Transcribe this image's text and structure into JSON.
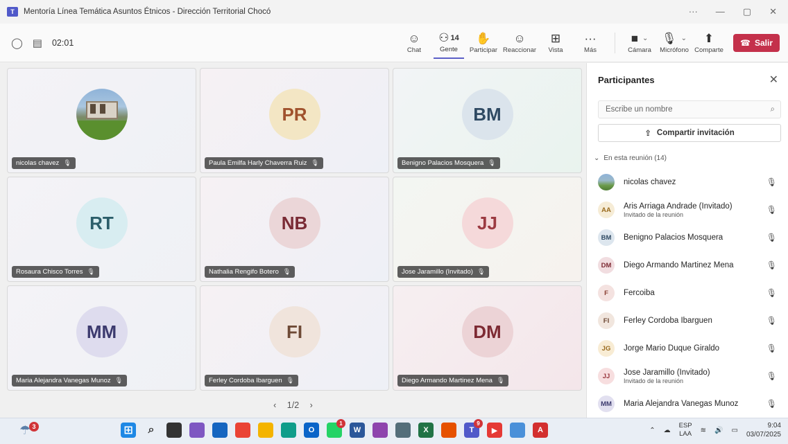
{
  "window": {
    "title": "Mentoría Línea Temática Asuntos Étnicos - Dirección Territorial Chocó",
    "controls": [
      "···",
      "—",
      "▢",
      "✕"
    ]
  },
  "toolbar": {
    "timer": "02:01",
    "buttons": {
      "chat": "Chat",
      "people": "Gente",
      "people_count": "14",
      "raise": "Participar",
      "react": "Reaccionar",
      "view": "Vista",
      "more": "Más",
      "camera": "Cámara",
      "mic": "Micrófono",
      "share": "Comparte",
      "leave": "Salir"
    }
  },
  "grid": {
    "tiles": [
      {
        "initials": "",
        "name": "nicolas chavez",
        "photo": true
      },
      {
        "initials": "PR",
        "name": "Paula Emilfa Harly Chaverra Ruiz",
        "bg": "#f3e6c4",
        "fg": "#a0522d"
      },
      {
        "initials": "BM",
        "name": "Benigno Palacios Mosquera",
        "bg": "#dbe4ec",
        "fg": "#2f4a63"
      },
      {
        "initials": "RT",
        "name": "Rosaura Chisco Torres",
        "bg": "#d8edf1",
        "fg": "#2c5e6a"
      },
      {
        "initials": "NB",
        "name": "Nathalia Rengifo Botero",
        "bg": "#ebd6d8",
        "fg": "#7a2b35"
      },
      {
        "initials": "JJ",
        "name": "Jose Jaramillo (Invitado)",
        "bg": "#f5d9da",
        "fg": "#9c3b42"
      },
      {
        "initials": "MM",
        "name": "Maria Alejandra Vanegas Munoz",
        "bg": "#dedcee",
        "fg": "#3c3a6e"
      },
      {
        "initials": "FI",
        "name": "Ferley Cordoba Ibarguen",
        "bg": "#f0e4dc",
        "fg": "#6e4a36"
      },
      {
        "initials": "DM",
        "name": "Diego Armando Martinez Mena",
        "bg": "#ecd3d6",
        "fg": "#7d2a33"
      }
    ],
    "pager": "1/2"
  },
  "panel": {
    "title": "Participantes",
    "search_placeholder": "Escribe un nombre",
    "invite_label": "Compartir invitación",
    "section_label": "En esta reunión (14)",
    "participants": [
      {
        "initials": "",
        "name": "nicolas chavez",
        "sub": "",
        "photo": true
      },
      {
        "initials": "AA",
        "name": "Aris Arriaga Andrade (Invitado)",
        "sub": "Invitado de la reunión",
        "bg": "#f6ecd6",
        "fg": "#9a6b1e"
      },
      {
        "initials": "BM",
        "name": "Benigno Palacios Mosquera",
        "sub": "",
        "bg": "#dde6ee",
        "fg": "#2f4a63"
      },
      {
        "initials": "DM",
        "name": "Diego Armando Martinez Mena",
        "sub": "",
        "bg": "#f1dde0",
        "fg": "#7d2a33"
      },
      {
        "initials": "F",
        "name": "Fercoiba",
        "sub": "",
        "bg": "#f4e2e0",
        "fg": "#8a3e32"
      },
      {
        "initials": "FI",
        "name": "Ferley Cordoba Ibarguen",
        "sub": "",
        "bg": "#f1e6de",
        "fg": "#6e4a36"
      },
      {
        "initials": "JG",
        "name": "Jorge Mario Duque Giraldo",
        "sub": "",
        "bg": "#f8ecd4",
        "fg": "#9a6b1e"
      },
      {
        "initials": "JJ",
        "name": "Jose Jaramillo (Invitado)",
        "sub": "Invitado de la reunión",
        "bg": "#f7dedf",
        "fg": "#9c3b42"
      },
      {
        "initials": "MM",
        "name": "Maria Alejandra Vanegas Munoz",
        "sub": "",
        "bg": "#e2e0f0",
        "fg": "#3c3a6e"
      }
    ]
  },
  "taskbar": {
    "weather_badge": "3",
    "apps": [
      {
        "name": "windows-start",
        "color": "#1e88e5",
        "label": ""
      },
      {
        "name": "search",
        "color": "transparent",
        "label": ""
      },
      {
        "name": "task-view",
        "color": "#333333",
        "label": ""
      },
      {
        "name": "copilot",
        "color": "#7e57c2",
        "label": ""
      },
      {
        "name": "store",
        "color": "#1565c0",
        "label": ""
      },
      {
        "name": "chrome",
        "color": "#ea4335",
        "label": ""
      },
      {
        "name": "file-explorer",
        "color": "#f4b400",
        "label": ""
      },
      {
        "name": "edge",
        "color": "#0f9d8a",
        "label": ""
      },
      {
        "name": "outlook",
        "color": "#0a64c8",
        "label": "O"
      },
      {
        "name": "whatsapp",
        "color": "#25d366",
        "label": "",
        "badge": "1"
      },
      {
        "name": "word",
        "color": "#2b579a",
        "label": "W"
      },
      {
        "name": "media",
        "color": "#8e44ad",
        "label": ""
      },
      {
        "name": "calculator",
        "color": "#546e7a",
        "label": ""
      },
      {
        "name": "excel",
        "color": "#217346",
        "label": "X"
      },
      {
        "name": "app-orange",
        "color": "#e65100",
        "label": ""
      },
      {
        "name": "teams",
        "color": "#5059c9",
        "label": "T",
        "badge": "9"
      },
      {
        "name": "youtube",
        "color": "#e53935",
        "label": "▶"
      },
      {
        "name": "notepad",
        "color": "#4a90d9",
        "label": ""
      },
      {
        "name": "acrobat",
        "color": "#d32f2f",
        "label": "A"
      }
    ],
    "lang_top": "ESP",
    "lang_bottom": "LAA",
    "time": "9:04",
    "date": "03/07/2025"
  }
}
